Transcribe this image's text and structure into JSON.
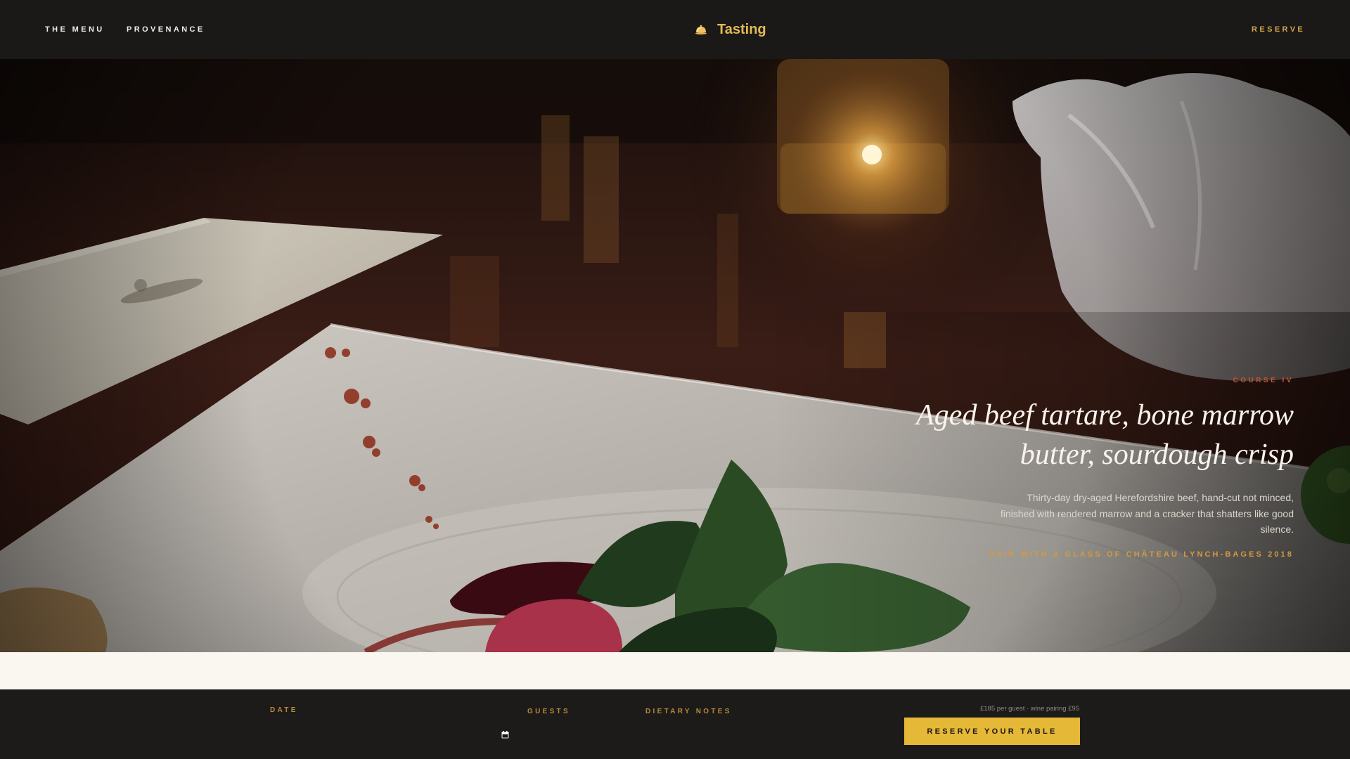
{
  "nav": {
    "links": [
      {
        "label": "THE MENU"
      },
      {
        "label": "PROVENANCE"
      }
    ],
    "brand_icon": "cloche-icon",
    "brand_name": "Tasting",
    "reserve_label": "RESERVE"
  },
  "hero": {
    "course_label": "COURSE IV",
    "dish_title": "Aged beef tartare, bone marrow butter, sourdough crisp",
    "description": "Thirty-day dry-aged Herefordshire beef, hand-cut not minced, finished with rendered marrow and a cracker that shatters like good silence.",
    "pairing": "PAIR WITH A GLASS OF CHÂTEAU LYNCH-BAGES 2018"
  },
  "booking": {
    "date_label": "DATE",
    "date_value": "",
    "calendar_icon": "calendar-icon",
    "guests_label": "GUESTS",
    "guests_value": "",
    "dietary_label": "DIETARY NOTES",
    "dietary_value": "",
    "price_note": "£185 per guest · wine pairing £95",
    "reserve_button": "RESERVE YOUR TABLE"
  },
  "colors": {
    "accent_gold": "#e6b838",
    "nav_background": "#1a1918",
    "cream_band": "#faf7f0",
    "course_label": "#c5542e"
  }
}
